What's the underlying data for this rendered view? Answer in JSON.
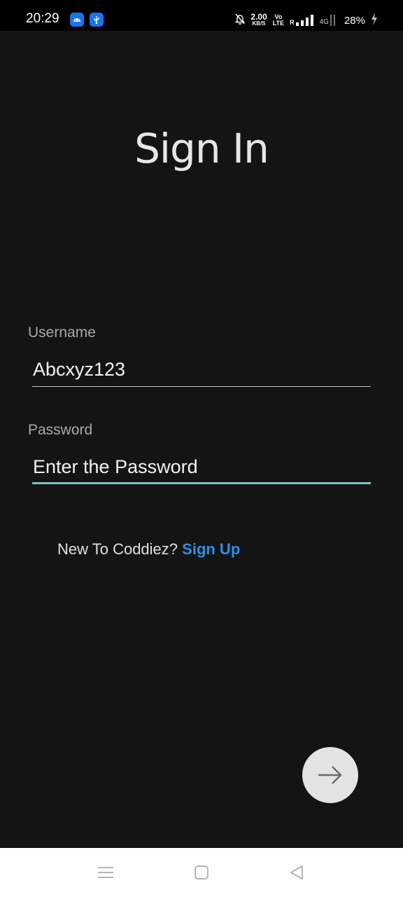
{
  "status_bar": {
    "time": "20:29",
    "net_speed": "2.00",
    "net_speed_unit": "KB/S",
    "volte_top": "Vo",
    "volte_bottom": "LTE",
    "roaming": "R",
    "network": "4G",
    "battery": "28%"
  },
  "screen": {
    "title": "Sign In"
  },
  "form": {
    "username_label": "Username",
    "username_value": "Abcxyz123",
    "password_label": "Password",
    "password_placeholder": "Enter the Password"
  },
  "signup": {
    "prompt": "New To Coddiez?",
    "link": "Sign Up"
  },
  "colors": {
    "background": "#141414",
    "accent_link": "#2f8fe6",
    "focused_underline": "#7fc0cc"
  },
  "icons": {
    "fab": "arrow-right-icon",
    "nav": [
      "menu-icon",
      "home-square-icon",
      "back-triangle-icon"
    ]
  }
}
